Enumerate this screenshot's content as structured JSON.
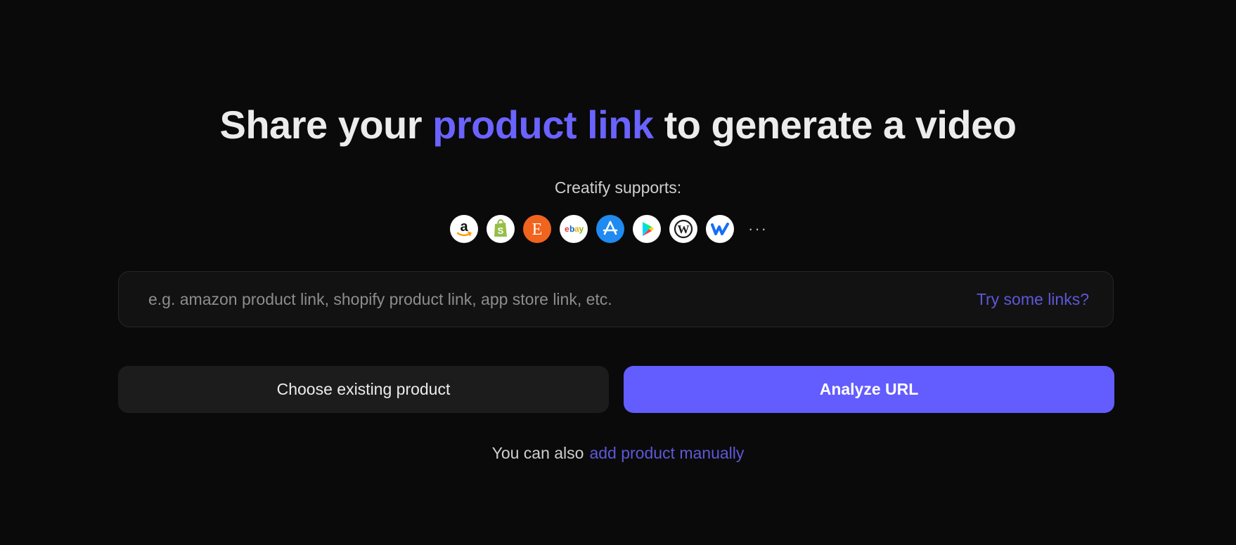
{
  "headline": {
    "before": "Share your ",
    "accent": "product link",
    "after": " to generate a video"
  },
  "supports": {
    "label": "Creatify supports:",
    "platforms": [
      {
        "name": "amazon-logo-icon"
      },
      {
        "name": "shopify-logo-icon"
      },
      {
        "name": "etsy-logo-icon"
      },
      {
        "name": "ebay-logo-icon"
      },
      {
        "name": "app-store-logo-icon"
      },
      {
        "name": "google-play-logo-icon"
      },
      {
        "name": "wordpress-logo-icon"
      },
      {
        "name": "webflow-logo-icon"
      }
    ],
    "more": "···"
  },
  "url_input": {
    "placeholder": "e.g. amazon product link, shopify product link, app store link, etc.",
    "value": "",
    "try_links_label": "Try some links?"
  },
  "actions": {
    "choose_existing_label": "Choose existing product",
    "analyze_label": "Analyze URL"
  },
  "footer": {
    "prefix": "You can also",
    "link_label": "add product manually"
  },
  "colors": {
    "background": "#0a0a0a",
    "accent": "#635cff",
    "link": "#5e58d8",
    "secondary_button": "#1c1c1c"
  }
}
